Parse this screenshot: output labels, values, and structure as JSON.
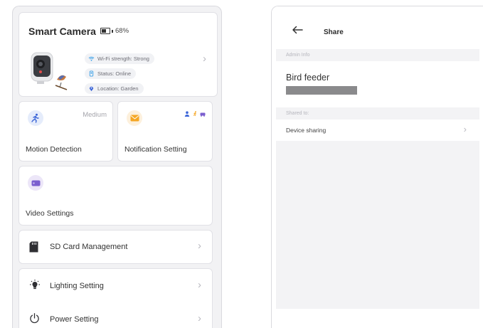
{
  "left_screen": {
    "camera_card": {
      "title": "Smart Camera",
      "battery_text": "68%",
      "battery_level": 0.68,
      "wifi": "Wi-Fi strength: Strong",
      "status": "Status: Online",
      "location": "Location: Garden"
    },
    "motion": {
      "label": "Motion Detection",
      "level": "Medium"
    },
    "notification": {
      "label": "Notification Setting"
    },
    "video": {
      "label": "Video Settings"
    },
    "sd": {
      "label": "SD Card Management"
    },
    "lighting": {
      "label": "Lighting Setting"
    },
    "power": {
      "label": "Power Setting"
    },
    "colors": {
      "blue_accent": "#3a64d8",
      "orange_accent": "#f5a623",
      "purple_accent": "#7b5fcf"
    }
  },
  "right_screen": {
    "title": "Share",
    "admin_section": "Admin Info",
    "device_name": "Bird feeder",
    "shared_section": "Shared to:",
    "device_sharing": "Device sharing"
  }
}
